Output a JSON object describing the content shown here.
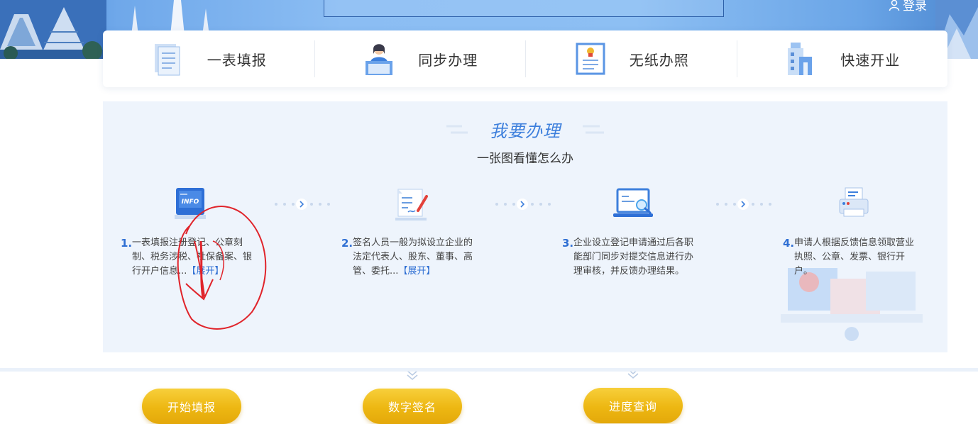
{
  "header": {
    "notice_text": "",
    "login_label": "登录"
  },
  "features": [
    {
      "label": "一表填报",
      "icon": "form-document-icon"
    },
    {
      "label": "同步办理",
      "icon": "clerk-desk-icon"
    },
    {
      "label": "无纸办照",
      "icon": "certificate-icon"
    },
    {
      "label": "快速开业",
      "icon": "building-icon"
    }
  ],
  "section": {
    "title": "我要办理",
    "subtitle": "一张图看懂怎么办"
  },
  "steps": [
    {
      "num": "1.",
      "line1": "一表填报注册登记、公章刻",
      "line2": "制、税务涉税、社保备案、银",
      "line3": "行开户信息...",
      "expand": "【展开】",
      "button": "开始填报",
      "icon": "info-monitor-icon"
    },
    {
      "num": "2.",
      "line1": "签名人员一般为拟设立企业的",
      "line2": "法定代表人、股东、董事、高",
      "line3": "管、委托...",
      "expand": "【展开】",
      "button": "数字签名",
      "icon": "signature-document-icon"
    },
    {
      "num": "3.",
      "line1": "企业设立登记申请通过后各职",
      "line2": "能部门同步对提交信息进行办",
      "line3": "理审核，并反馈办理结果。",
      "expand": "",
      "button": "进度查询",
      "icon": "laptop-search-icon"
    },
    {
      "num": "4.",
      "line1": "申请人根据反馈信息领取营业",
      "line2": "执照、公章、发票、银行开",
      "line3": "户。",
      "expand": "",
      "button": "",
      "icon": "printer-icon"
    }
  ],
  "colors": {
    "accent_blue": "#3d7fdc",
    "button_yellow": "#edb712",
    "annotation_red": "#e0242b"
  }
}
